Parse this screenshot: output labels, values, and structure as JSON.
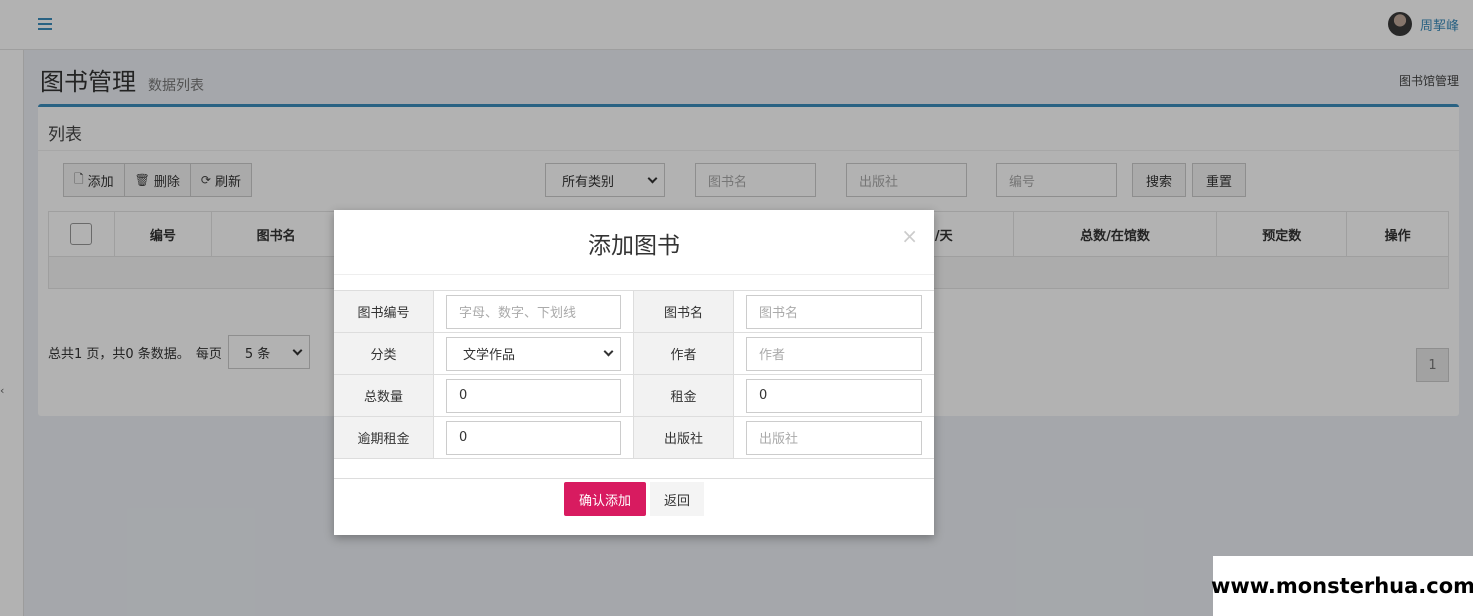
{
  "header": {
    "menu_icon": "hamburger-icon",
    "user_name": "周挈峰"
  },
  "content": {
    "title": "图书管理",
    "subtitle": "数据列表",
    "breadcrumb": "图书馆管理"
  },
  "box": {
    "title": "列表",
    "toolbar": {
      "add_label": "添加",
      "delete_label": "删除",
      "refresh_label": "刷新"
    },
    "filters": {
      "category": "所有类别",
      "name_placeholder": "图书名",
      "publisher_placeholder": "出版社",
      "number_placeholder": "编号",
      "search_label": "搜索",
      "reset_label": "重置"
    },
    "table": {
      "columns": [
        "编号",
        "图书名",
        "/天",
        "总数/在馆数",
        "预定数",
        "操作"
      ]
    },
    "pager": {
      "summary": "总共1 页，共0 条数据。",
      "per_page_label": "每页",
      "page_size": "5 条",
      "current_page": "1"
    }
  },
  "modal": {
    "title": "添加图书",
    "close": "×",
    "fields": {
      "book_no_label": "图书编号",
      "book_no_placeholder": "字母、数字、下划线",
      "book_name_label": "图书名",
      "book_name_placeholder": "图书名",
      "category_label": "分类",
      "category_value": "文学作品",
      "author_label": "作者",
      "author_placeholder": "作者",
      "total_label": "总数量",
      "total_value": "0",
      "rent_label": "租金",
      "rent_value": "0",
      "overdue_label": "逾期租金",
      "overdue_value": "0",
      "publisher_label": "出版社",
      "publisher_placeholder": "出版社"
    },
    "confirm_label": "确认添加",
    "back_label": "返回"
  },
  "watermark": "www.monsterhua.com"
}
